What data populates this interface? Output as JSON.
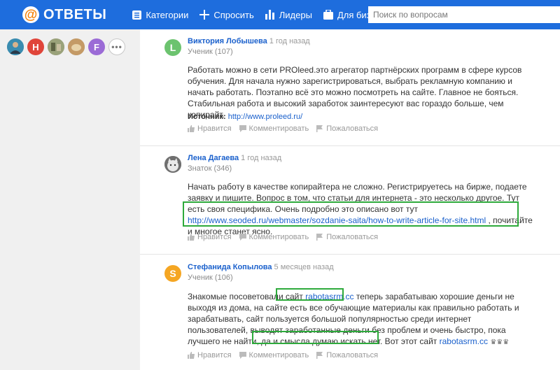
{
  "header": {
    "logo_symbol": "@",
    "logo_text": "ОТВЕТЫ",
    "nav": {
      "categories": "Категории",
      "ask": "Спросить",
      "leaders": "Лидеры",
      "business": "Для бизнеса"
    },
    "search_placeholder": "Поиск по вопросам"
  },
  "sidebar": {
    "avatars": [
      "",
      "Н",
      "",
      "",
      "F"
    ],
    "more": "•••"
  },
  "actions": {
    "like": "Нравится",
    "comment": "Комментировать",
    "report": "Пожаловаться"
  },
  "answers": [
    {
      "avatar_letter": "L",
      "avatar_color": "#6cc36f",
      "name": "Виктория Лобышева",
      "time": "1 год назад",
      "rank": "Ученик (107)",
      "text": "Работать можно в сети PROleed.это агрегатор партнёрских программ в сфере курсов обучения. Для начала нужно зарегистрироваться, выбрать рекламную компанию и начать работать. Поэтапно всё это можно посмотреть на сайте. Главное не бояться. Стабильная работа и высокий заработок заинтересуют вас гораздо больше, чем копирайт.",
      "source_label": "Источник:",
      "source_url": "http://www.proleed.ru/"
    },
    {
      "name": "Лена Дагаева",
      "time": "1 год назад",
      "rank": "Знаток (346)",
      "text_1": "Начать работу в качестве копирайтера не сложно. Регистрируетесь на бирже, подаете заявку и пишите. Вопрос в том, что статьи для интернета - это несколько другое. Тут есть своя специфика. Очень подробно это описано вот тут ",
      "link": "http://www.seoded.ru/webmaster/sozdanie-saita/how-to-write-article-for-site.html",
      "text_2": " , почитайте и многое станет ясно."
    },
    {
      "avatar_letter": "S",
      "avatar_color": "#f5a623",
      "name": "Стефанида Копылова",
      "time": "5 месяцев назад",
      "rank": "Ученик (106)",
      "text_1": "Знакомые посоветовали сайт ",
      "link_1": "rabotasrm.cc",
      "text_2": " теперь зарабатываю хорошие деньги не выходя из дома, на сайте есть все обучающие материалы как правильно работать и зарабатывать, сайт пользуется большой популярностью среди интернет пользователей, выводят заработанные деньги без проблем и очень быстро, пока лучшего не найти, да и смысла думаю искать нет. Вот этот сайт ",
      "link_2": "rabotasrm.cc",
      "emoji": "♛♛♛"
    }
  ]
}
